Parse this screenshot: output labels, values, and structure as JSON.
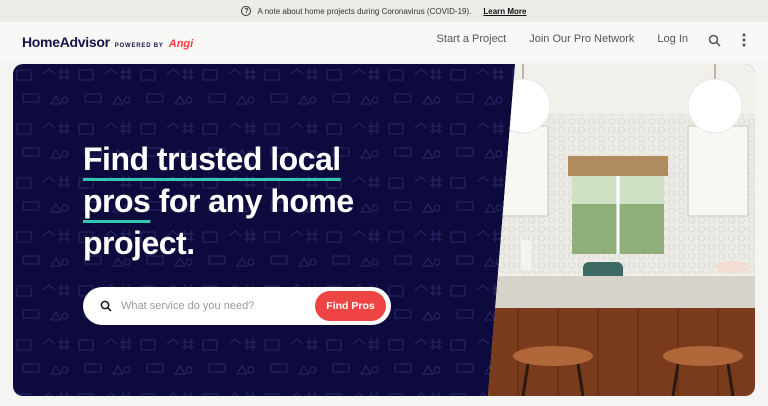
{
  "banner": {
    "message": "A note about home projects during Coronavirus (COVID-19).",
    "link": "Learn More"
  },
  "header": {
    "brand": "HomeAdvisor",
    "powered_by": "POWERED BY",
    "partner": "Angi",
    "nav": [
      "Start a Project",
      "Join Our Pro Network",
      "Log In"
    ],
    "icons": [
      "search-icon",
      "more-vertical-icon"
    ]
  },
  "hero": {
    "headline_part1": "Find trusted local",
    "headline_part2": "pros",
    "headline_part3": " for any home project.",
    "search_placeholder": "What service do you need?",
    "search_button": "Find Pros"
  },
  "colors": {
    "hero_bg": "#0d0b3d",
    "accent_underline": "#33c7b0",
    "button": "#ef4444",
    "angi": "#ff3a3a"
  }
}
